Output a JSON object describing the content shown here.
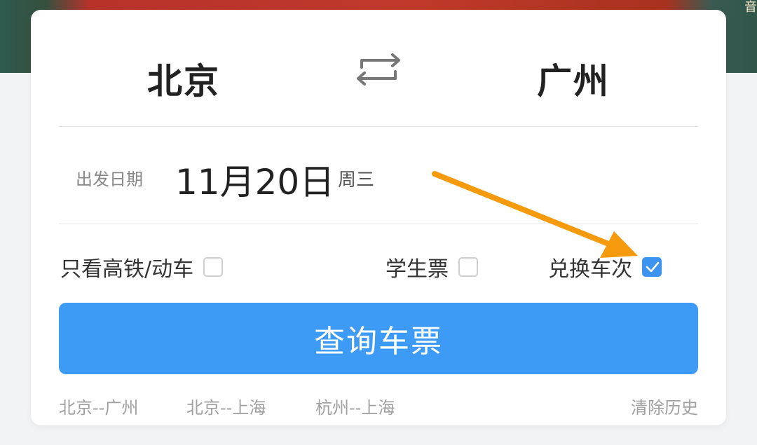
{
  "banner": {
    "text": "音"
  },
  "route": {
    "from": "北京",
    "to": "广州",
    "swap_icon": "swap-arrows-icon"
  },
  "date": {
    "label": "出发日期",
    "value": "11月20日",
    "weekday": "周三"
  },
  "options": [
    {
      "label": "只看高铁/动车",
      "checked": false
    },
    {
      "label": "学生票",
      "checked": false
    },
    {
      "label": "兑换车次",
      "checked": true
    }
  ],
  "search_button": {
    "label": "查询车票"
  },
  "history": {
    "items": [
      "北京--广州",
      "北京--上海",
      "杭州--上海"
    ],
    "clear_label": "清除历史"
  },
  "colors": {
    "accent": "#3e9bf5",
    "annotation_arrow": "#f59a0c",
    "banner": "#c0392b"
  }
}
